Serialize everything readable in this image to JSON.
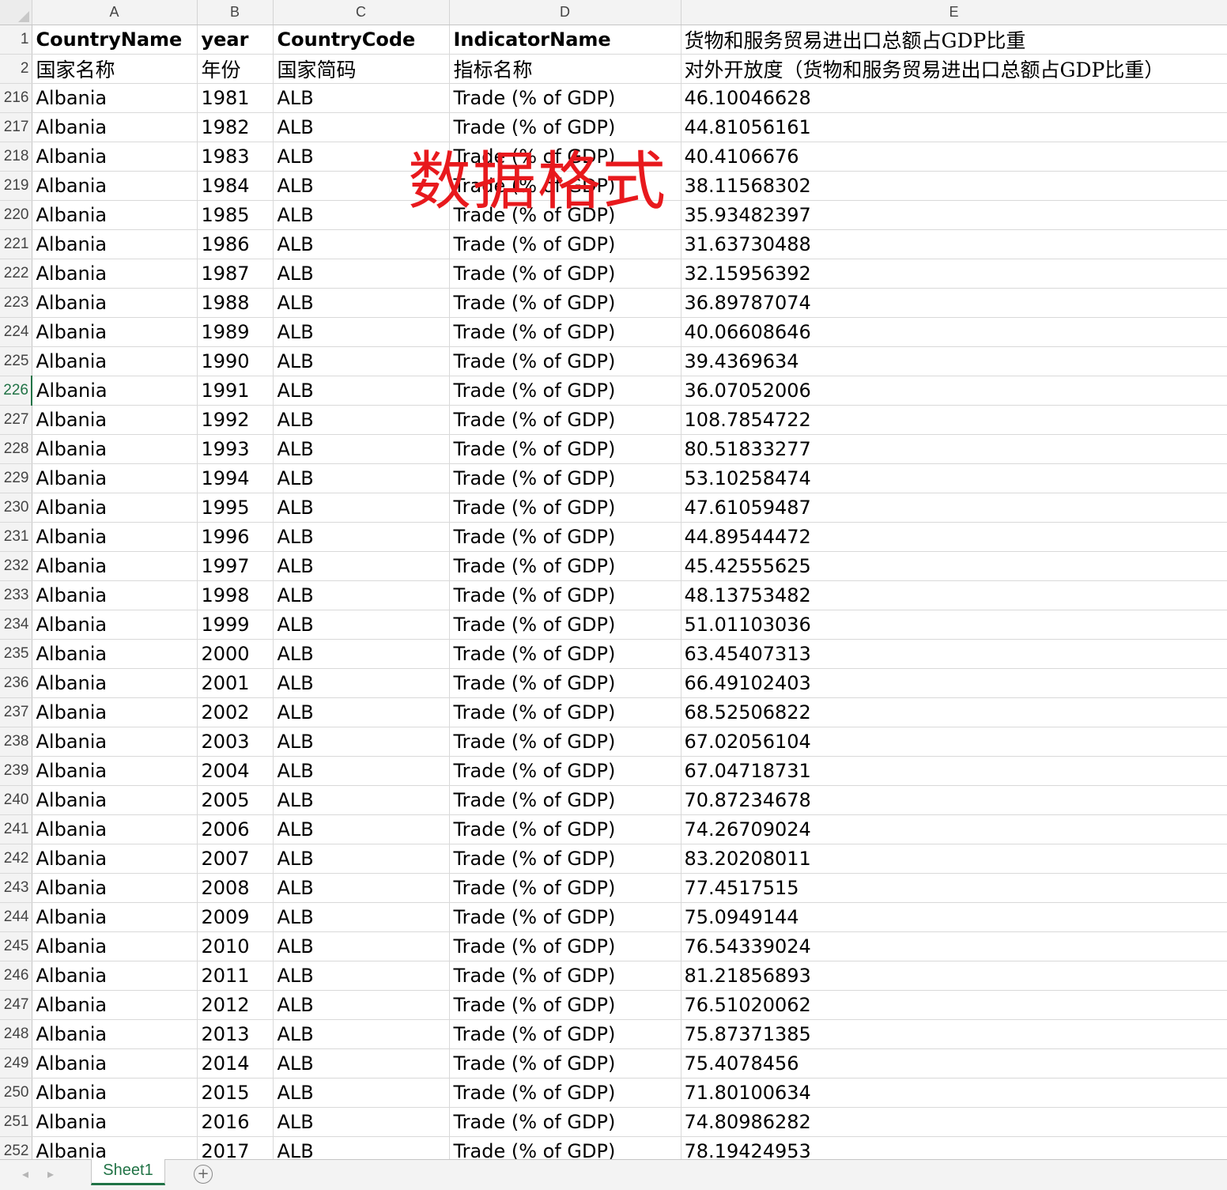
{
  "spreadsheet": {
    "columns": [
      "A",
      "B",
      "C",
      "D",
      "E"
    ],
    "header_rows": [
      {
        "row": "1",
        "cells": [
          "CountryName",
          "year",
          "CountryCode",
          "IndicatorName",
          "货物和服务贸易进出口总额占GDP比重"
        ]
      },
      {
        "row": "2",
        "cells": [
          "国家名称",
          "年份",
          "国家简码",
          "指标名称",
          "对外开放度（货物和服务贸易进出口总额占GDP比重）"
        ]
      }
    ],
    "rows": [
      {
        "row": "216",
        "cells": [
          "Albania",
          "1981",
          "ALB",
          "Trade (% of GDP)",
          "46.10046628"
        ]
      },
      {
        "row": "217",
        "cells": [
          "Albania",
          "1982",
          "ALB",
          "Trade (% of GDP)",
          "44.81056161"
        ]
      },
      {
        "row": "218",
        "cells": [
          "Albania",
          "1983",
          "ALB",
          "Trade (% of GDP)",
          "40.4106676"
        ]
      },
      {
        "row": "219",
        "cells": [
          "Albania",
          "1984",
          "ALB",
          "Trade (% of GDP)",
          "38.11568302"
        ]
      },
      {
        "row": "220",
        "cells": [
          "Albania",
          "1985",
          "ALB",
          "Trade (% of GDP)",
          "35.93482397"
        ]
      },
      {
        "row": "221",
        "cells": [
          "Albania",
          "1986",
          "ALB",
          "Trade (% of GDP)",
          "31.63730488"
        ]
      },
      {
        "row": "222",
        "cells": [
          "Albania",
          "1987",
          "ALB",
          "Trade (% of GDP)",
          "32.15956392"
        ]
      },
      {
        "row": "223",
        "cells": [
          "Albania",
          "1988",
          "ALB",
          "Trade (% of GDP)",
          "36.89787074"
        ]
      },
      {
        "row": "224",
        "cells": [
          "Albania",
          "1989",
          "ALB",
          "Trade (% of GDP)",
          "40.06608646"
        ]
      },
      {
        "row": "225",
        "cells": [
          "Albania",
          "1990",
          "ALB",
          "Trade (% of GDP)",
          "39.4369634"
        ]
      },
      {
        "row": "226",
        "cells": [
          "Albania",
          "1991",
          "ALB",
          "Trade (% of GDP)",
          "36.07052006"
        ]
      },
      {
        "row": "227",
        "cells": [
          "Albania",
          "1992",
          "ALB",
          "Trade (% of GDP)",
          "108.7854722"
        ]
      },
      {
        "row": "228",
        "cells": [
          "Albania",
          "1993",
          "ALB",
          "Trade (% of GDP)",
          "80.51833277"
        ]
      },
      {
        "row": "229",
        "cells": [
          "Albania",
          "1994",
          "ALB",
          "Trade (% of GDP)",
          "53.10258474"
        ]
      },
      {
        "row": "230",
        "cells": [
          "Albania",
          "1995",
          "ALB",
          "Trade (% of GDP)",
          "47.61059487"
        ]
      },
      {
        "row": "231",
        "cells": [
          "Albania",
          "1996",
          "ALB",
          "Trade (% of GDP)",
          "44.89544472"
        ]
      },
      {
        "row": "232",
        "cells": [
          "Albania",
          "1997",
          "ALB",
          "Trade (% of GDP)",
          "45.42555625"
        ]
      },
      {
        "row": "233",
        "cells": [
          "Albania",
          "1998",
          "ALB",
          "Trade (% of GDP)",
          "48.13753482"
        ]
      },
      {
        "row": "234",
        "cells": [
          "Albania",
          "1999",
          "ALB",
          "Trade (% of GDP)",
          "51.01103036"
        ]
      },
      {
        "row": "235",
        "cells": [
          "Albania",
          "2000",
          "ALB",
          "Trade (% of GDP)",
          "63.45407313"
        ]
      },
      {
        "row": "236",
        "cells": [
          "Albania",
          "2001",
          "ALB",
          "Trade (% of GDP)",
          "66.49102403"
        ]
      },
      {
        "row": "237",
        "cells": [
          "Albania",
          "2002",
          "ALB",
          "Trade (% of GDP)",
          "68.52506822"
        ]
      },
      {
        "row": "238",
        "cells": [
          "Albania",
          "2003",
          "ALB",
          "Trade (% of GDP)",
          "67.02056104"
        ]
      },
      {
        "row": "239",
        "cells": [
          "Albania",
          "2004",
          "ALB",
          "Trade (% of GDP)",
          "67.04718731"
        ]
      },
      {
        "row": "240",
        "cells": [
          "Albania",
          "2005",
          "ALB",
          "Trade (% of GDP)",
          "70.87234678"
        ]
      },
      {
        "row": "241",
        "cells": [
          "Albania",
          "2006",
          "ALB",
          "Trade (% of GDP)",
          "74.26709024"
        ]
      },
      {
        "row": "242",
        "cells": [
          "Albania",
          "2007",
          "ALB",
          "Trade (% of GDP)",
          "83.20208011"
        ]
      },
      {
        "row": "243",
        "cells": [
          "Albania",
          "2008",
          "ALB",
          "Trade (% of GDP)",
          "77.4517515"
        ]
      },
      {
        "row": "244",
        "cells": [
          "Albania",
          "2009",
          "ALB",
          "Trade (% of GDP)",
          "75.0949144"
        ]
      },
      {
        "row": "245",
        "cells": [
          "Albania",
          "2010",
          "ALB",
          "Trade (% of GDP)",
          "76.54339024"
        ]
      },
      {
        "row": "246",
        "cells": [
          "Albania",
          "2011",
          "ALB",
          "Trade (% of GDP)",
          "81.21856893"
        ]
      },
      {
        "row": "247",
        "cells": [
          "Albania",
          "2012",
          "ALB",
          "Trade (% of GDP)",
          "76.51020062"
        ]
      },
      {
        "row": "248",
        "cells": [
          "Albania",
          "2013",
          "ALB",
          "Trade (% of GDP)",
          "75.87371385"
        ]
      },
      {
        "row": "249",
        "cells": [
          "Albania",
          "2014",
          "ALB",
          "Trade (% of GDP)",
          "75.4078456"
        ]
      },
      {
        "row": "250",
        "cells": [
          "Albania",
          "2015",
          "ALB",
          "Trade (% of GDP)",
          "71.80100634"
        ]
      },
      {
        "row": "251",
        "cells": [
          "Albania",
          "2016",
          "ALB",
          "Trade (% of GDP)",
          "74.80986282"
        ]
      },
      {
        "row": "252",
        "cells": [
          "Albania",
          "2017",
          "ALB",
          "Trade (% of GDP)",
          "78.19424953"
        ]
      }
    ],
    "selected_row": "226"
  },
  "watermark": "数据格式",
  "tabs": {
    "nav_prev_icon": "triangle-left-icon",
    "nav_next_icon": "triangle-right-icon",
    "sheet_name": "Sheet1",
    "add_sheet_label": "+"
  },
  "colors": {
    "accent": "#217346",
    "watermark": "#e8191d"
  }
}
